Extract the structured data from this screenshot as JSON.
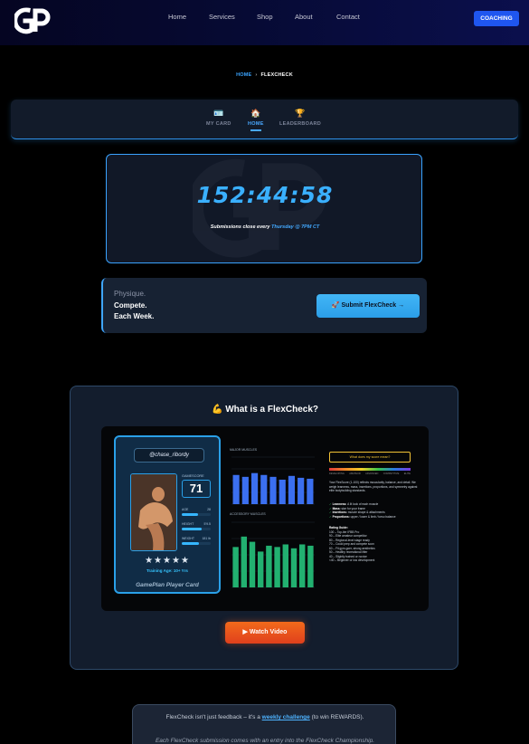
{
  "header": {
    "nav": [
      "Home",
      "Services",
      "Shop",
      "About",
      "Contact"
    ],
    "cta_label": "COACHING"
  },
  "breadcrumb": {
    "home": "HOME",
    "separator": "›",
    "current": "FLEXCHECK"
  },
  "tabs": [
    {
      "label": "MY CARD",
      "icon": "id-card-icon",
      "active": false
    },
    {
      "label": "HOME",
      "icon": "house-icon",
      "active": true
    },
    {
      "label": "LEADERBOARD",
      "icon": "trophy-icon",
      "active": false
    }
  ],
  "countdown": {
    "timer": "152:44:58",
    "prefix": "Submissions close every ",
    "highlight": "Thursday @ 7PM CT"
  },
  "promo": {
    "line1": "Physique.",
    "line2": "Compete.",
    "line3": "Each Week.",
    "button_label": "Submit FlexCheck →",
    "button_icon": "rocket-icon"
  },
  "what_is": {
    "title": "💪 What is a FlexCheck?",
    "watch_label": "▶ Watch Video",
    "player_card": {
      "handle": "@chase_ribordy",
      "gamescore_label": "GAMESCORE",
      "gamescore": "71",
      "stats": [
        {
          "label": "AGE",
          "value": "28",
          "fill": 0.55
        },
        {
          "label": "HEIGHT",
          "value": "5'9.5",
          "fill": 0.7
        },
        {
          "label": "WEIGHT",
          "value": "181 lb",
          "fill": 0.6
        }
      ],
      "stars": "★★★★★",
      "training_age": "Training Age: 10+ Yrs",
      "card_name": "GamePlan Player Card"
    },
    "charts": {
      "top_label": "MAJOR MUSCLES",
      "top_values": [
        62,
        58,
        66,
        62,
        58,
        52,
        60,
        56,
        54
      ],
      "bottom_label": "ACCESSORY MUSCLES",
      "bottom_values": [
        62,
        78,
        70,
        55,
        64,
        62,
        66,
        60,
        66,
        64
      ],
      "colors": {
        "major": "#3b6ff0",
        "accessory": "#22b070"
      }
    },
    "info": {
      "question": "What does my score mean?",
      "scale_labels": [
        "DEVELOPING",
        "AMATEUR",
        "ADVANCED",
        "COMPETITIVE",
        "ELITE"
      ],
      "intro": "Your FlexScore (1-100) reflects muscularity, balance, and detail. We weigh leanness, mass, insertions, proportions, and symmetry against elite bodybuilding standards.",
      "checks": [
        {
          "k": "Leanness:",
          "v": "A lit look of each muscle"
        },
        {
          "k": "Mass:",
          "v": "size for your frame"
        },
        {
          "k": "Insertions:",
          "v": "muscle shape & attachments"
        },
        {
          "k": "Proportions:",
          "v": "upper / lower & limb / torso balance"
        }
      ],
      "rating_title": "Rating Guide:",
      "ratings": [
        "100 – Top-tier IFBB Pro",
        "90 – Elite amateur competitor",
        "80 – Regional-level stage ready",
        "70 – Could prep and compete soon",
        "60 – Fit gym-goer, strong aesthetics",
        "50 – Healthy recreational lifter",
        "40 – Slightly trained or novice",
        "<40 – Beginner or low development"
      ]
    }
  },
  "note": {
    "text_before": "FlexCheck isn't just feedback – it's a ",
    "link": "weekly challenge",
    "text_after": " (to win REWARDS).",
    "line2": "Each FlexCheck submission comes with an entry into the FlexCheck Championship."
  }
}
